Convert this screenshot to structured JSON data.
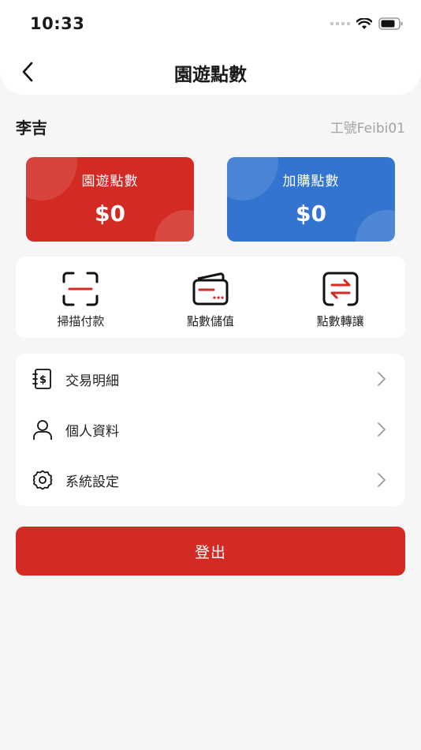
{
  "status_bar": {
    "time": "10:33"
  },
  "header": {
    "title": "園遊點數",
    "back_icon": "chevron-left-icon"
  },
  "user": {
    "name": "李吉",
    "employee_id": "工號Feibi01"
  },
  "cards": [
    {
      "label": "園遊點數",
      "value": "$0",
      "color": "#d42a24"
    },
    {
      "label": "加購點數",
      "value": "$0",
      "color": "#3274d0"
    }
  ],
  "actions": [
    {
      "label": "掃描付款",
      "icon": "scan-icon"
    },
    {
      "label": "點數儲值",
      "icon": "wallet-icon"
    },
    {
      "label": "點數轉讓",
      "icon": "transfer-icon"
    }
  ],
  "menu": [
    {
      "label": "交易明細",
      "icon": "receipt-dollar-icon"
    },
    {
      "label": "個人資料",
      "icon": "user-icon"
    },
    {
      "label": "系統設定",
      "icon": "gear-icon"
    }
  ],
  "logout_label": "登出",
  "colors": {
    "brand_red": "#d42a24",
    "brand_blue": "#3274d0",
    "background": "#f6f6f6"
  }
}
